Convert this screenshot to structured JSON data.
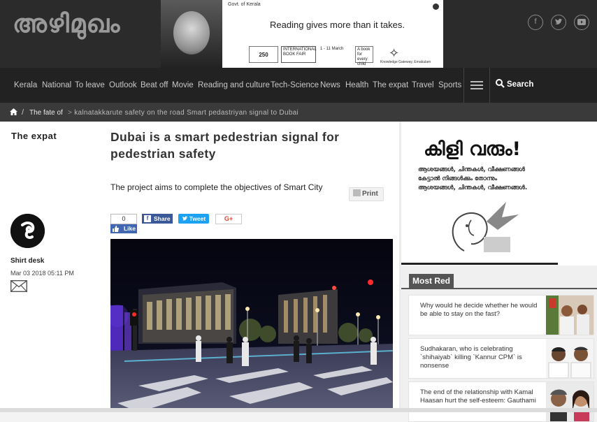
{
  "header": {
    "logo_text": "അഴിമുഖം",
    "social_icons": [
      "facebook-icon",
      "twitter-icon",
      "youtube-icon"
    ]
  },
  "ad_banner": {
    "bank": "Govt. of Kerala",
    "headline": "Reading gives more than it takes.",
    "badge_250": "250",
    "fair_title": "INTERNATIONAL BOOK FAIR",
    "fair_dates": "1 - 11 March",
    "tagline": "A book for every child",
    "partner": "Knowledge Gateway, Ernakulam"
  },
  "nav": {
    "items": [
      "Kerala",
      "National",
      "To leave",
      "Outlook",
      "Beat off",
      "Movie",
      "Reading and culture",
      "Tech-Science",
      "News",
      "Health",
      "The expat",
      "Travel",
      "Sports"
    ],
    "search_label": "Search"
  },
  "breadcrumb": {
    "sep": "/",
    "category": "The fate of",
    "current_prefix": ">",
    "current": "kalnatakkarute safety on the road Smart pedastriyan signal to Dubai"
  },
  "article": {
    "section": "The expat",
    "author": "Shirt desk",
    "date": "Mar 03 2018 05:11 PM",
    "headline": "Dubai is a smart pedestrian signal for pedestrian safety",
    "summary": "The project aims to complete the objectives of Smart City",
    "print_label": "Print",
    "like_count": "0",
    "like_label": "Like",
    "share_label": "Share",
    "tweet_label": "Tweet",
    "gplus_label": "G+"
  },
  "sidebar_ad": {
    "title": "കിളി വരും!",
    "line1": "ആശയങ്ങൾ, ചിന്തകൾ, വീക്ഷണങ്ങൾ",
    "line2": "കേട്ടാൽ നിങ്ങൾക്കും തോന്നും",
    "line3": "ആശയങ്ങൾ, ചിന്തകൾ, വീക്ഷണങ്ങൾ."
  },
  "most_read": {
    "title": "Most Red",
    "items": [
      {
        "text": "Why would he decide whether he would be able to stay on the fast?"
      },
      {
        "text": "Sudhakaran, who is celebrating `shihaiyab` killing `Kannur CPM` is nonsense"
      },
      {
        "text": "The end of the relationship with Kamal Haasan hurt the self-esteem: Gauthami"
      }
    ]
  }
}
